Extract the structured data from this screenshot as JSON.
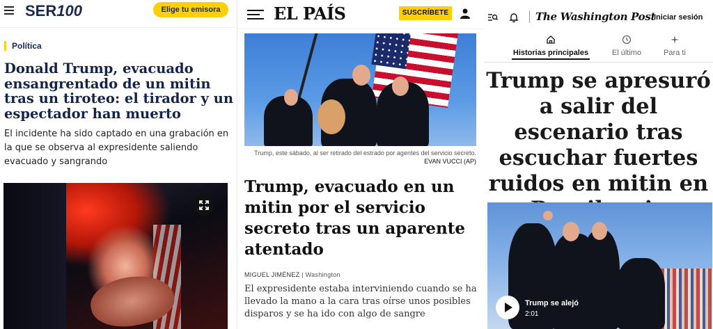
{
  "ser": {
    "logo": "SER",
    "logo_suffix": "100",
    "station_button": "Elige tu emisora",
    "section": "Política",
    "headline": "Donald Trump, evacuado ensangrentado de un mitin tras un tiroteo: el tirador y un espectador han muerto",
    "lede": "El incidente ha sido captado en una grabación en la que se observa al expresidente saliendo evacuado y sangrando",
    "icons": {
      "menu": "hamburger-menu-icon",
      "expand": "expand-icon"
    },
    "accent": "#ffd000"
  },
  "elpais": {
    "logo": "EL PAÍS",
    "subscribe_button": "SUSCRÍBETE",
    "caption": "Trump, este sábado, al ser retirado del estrado por agentes del servicio secreto.",
    "credit": "EVAN VUCCI (AP)",
    "headline": "Trump, evacuado en un mitin por el servicio secreto tras un aparente atentado",
    "author": "MIGUEL JIMÉNEZ",
    "location": "Washington",
    "lede": "El expresidente estaba interviniendo cuando se ha llevado la mano a la cara tras oírse unos posibles disparos y se ha ido con algo de sangre",
    "icons": {
      "menu": "hamburger-menu-icon",
      "user": "user-icon"
    },
    "accent": "#ffd000"
  },
  "wapo": {
    "logo": "The Washington Post",
    "signin": "Iniciar sesión",
    "tabs": [
      {
        "label": "Historias principales",
        "icon": "home-icon"
      },
      {
        "label": "El último",
        "icon": "clock-icon"
      },
      {
        "label": "Para ti",
        "icon": "sparkle-icon"
      }
    ],
    "headline": "Trump se apresuró a salir del escenario tras escuchar fuertes ruidos en mitin en Pensilvania",
    "video_title": "Trump se alejó",
    "video_duration": "2:01",
    "icons": {
      "search": "search-menu-icon",
      "bell": "bell-icon",
      "play": "play-icon"
    }
  }
}
